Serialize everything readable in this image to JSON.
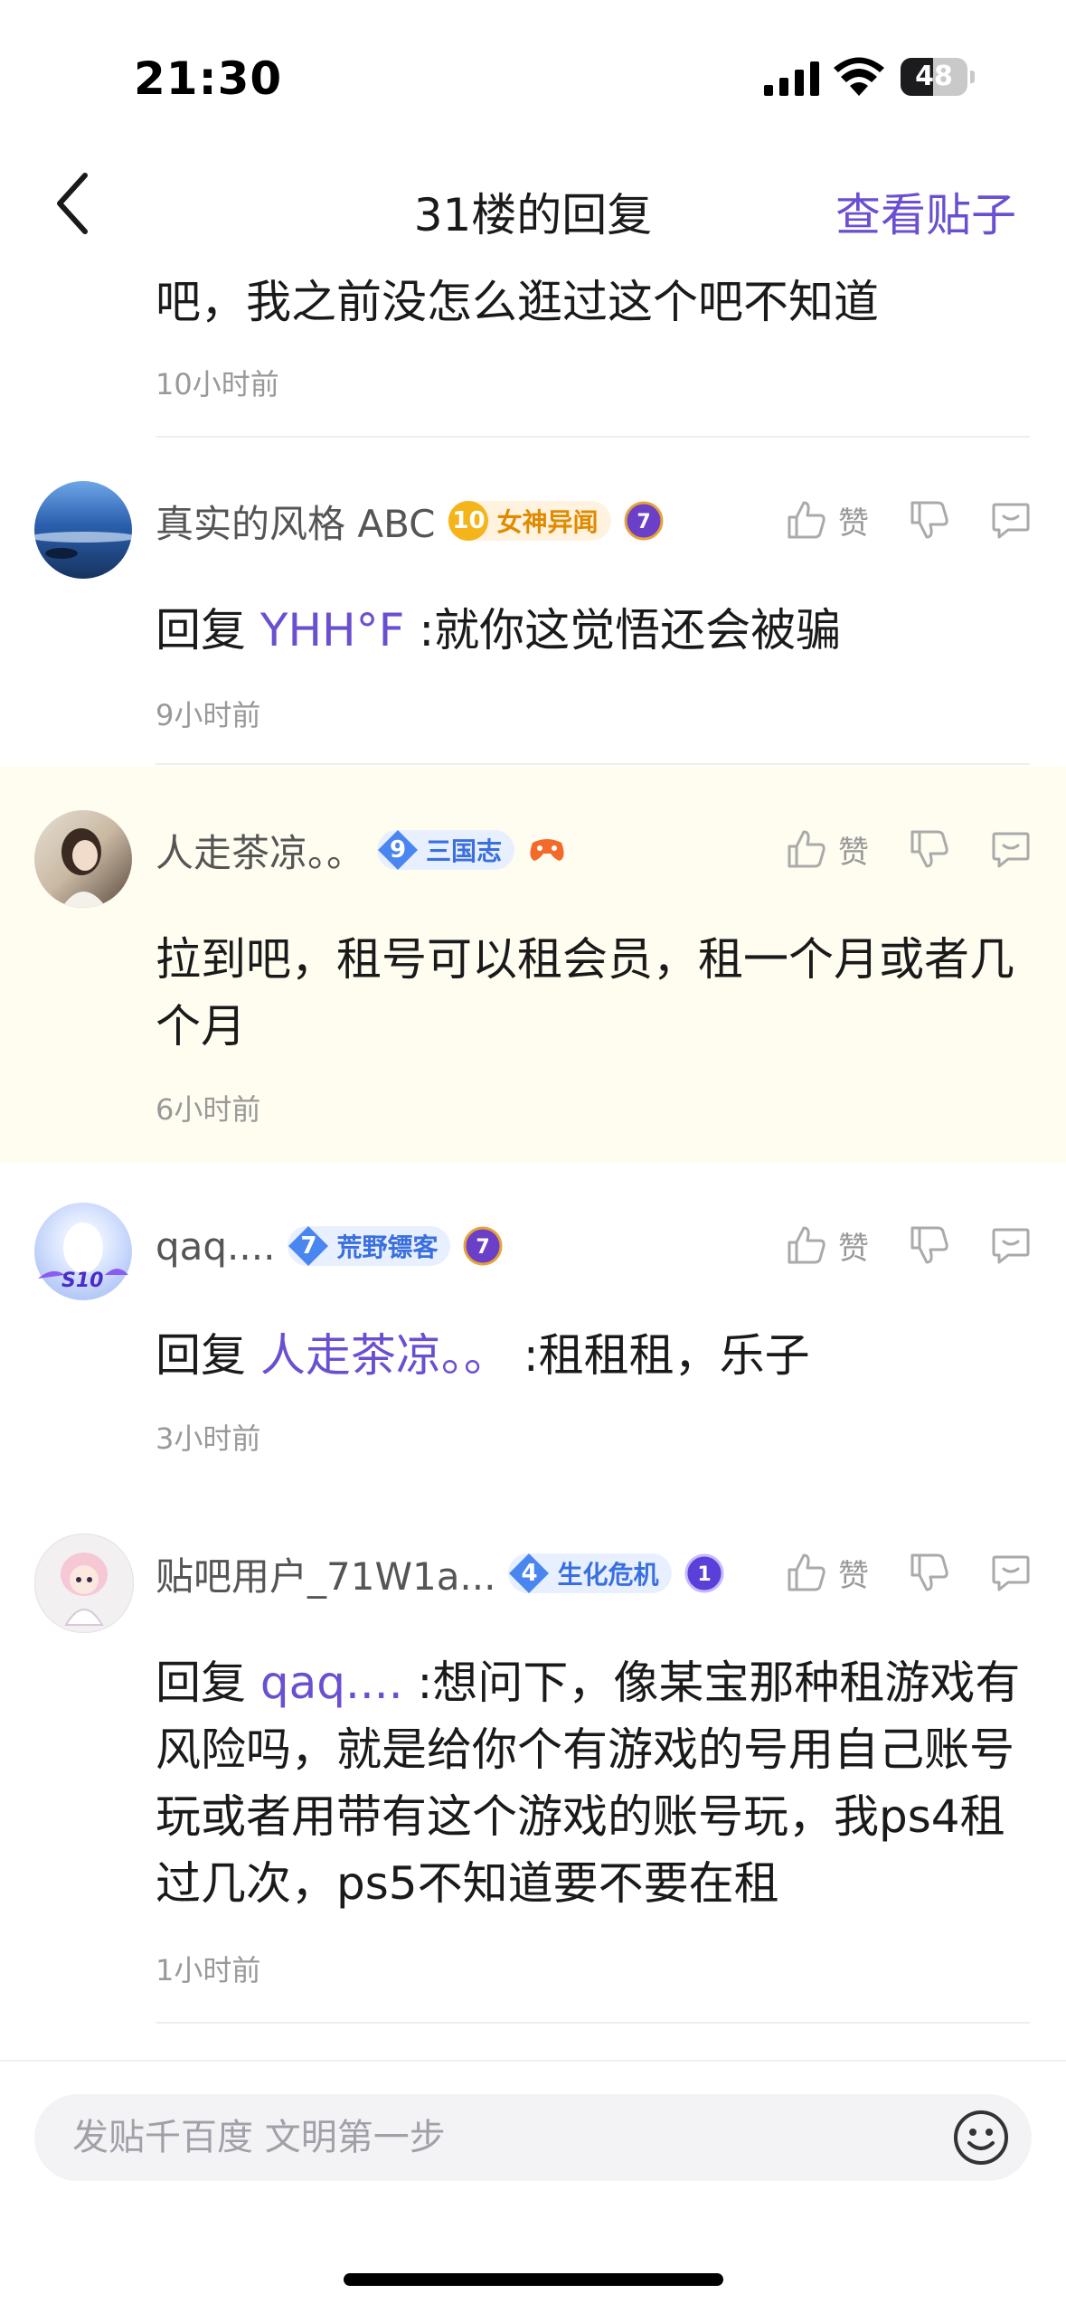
{
  "status_bar": {
    "time": "21:30",
    "battery": "48",
    "battery_level": 0.48
  },
  "nav": {
    "title": "31楼的回复",
    "view_post": "查看贴子"
  },
  "header_post": {
    "text": "吧，我之前没怎么逛过这个吧不知道",
    "time": "10小时前"
  },
  "replies": [
    {
      "user": "真实的风格 ABC",
      "level": "10",
      "forum": "女神异闻",
      "badge_color": "gold",
      "medal": "7",
      "prefix": "回复",
      "mention": "YHH°F",
      "content": ":就你这觉悟还会被骗",
      "time": "9小时前",
      "like_label": "赞",
      "highlight": false
    },
    {
      "user": "人走茶凉。。",
      "level": "9",
      "forum": "三国志",
      "badge_color": "blue",
      "medal": "",
      "prefix": "",
      "mention": "",
      "content": "拉到吧，租号可以租会员，租一个月或者几个月",
      "time": "6小时前",
      "like_label": "赞",
      "highlight": true
    },
    {
      "user": "qaq....",
      "level": "7",
      "forum": "荒野镖客",
      "badge_color": "blue",
      "medal": "7",
      "prefix": "回复",
      "mention": "人走茶凉。。",
      "content": ":租租租，乐子",
      "time": "3小时前",
      "like_label": "赞",
      "highlight": false,
      "avatar_tag": "S10"
    },
    {
      "user": "贴吧用户_71W1a...",
      "level": "4",
      "forum": "生化危机",
      "badge_color": "blue",
      "medal": "1",
      "prefix": "回复",
      "mention": "qaq....",
      "content": ":想问下，像某宝那种租游戏有风险吗，就是给你个有游戏的号用自己账号玩或者用带有这个游戏的账号玩，我ps4租过几次，ps5不知道要不要在租",
      "time": "1小时前",
      "like_label": "赞",
      "highlight": false
    }
  ],
  "input": {
    "placeholder": "发贴千百度 文明第一步"
  },
  "icons": [
    "back-icon",
    "signal-icon",
    "wifi-icon",
    "battery-icon",
    "thumb-up-icon",
    "thumb-down-icon",
    "comment-icon",
    "emoji-icon"
  ],
  "colors": {
    "accent": "#6b4fd1",
    "highlight_bg": "#fffdf0",
    "badge_blue": "#3a6fe0",
    "badge_gold": "#e08a00"
  }
}
